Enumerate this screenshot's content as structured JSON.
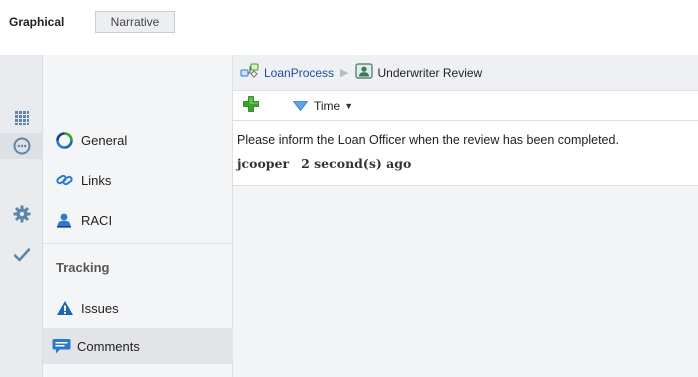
{
  "tabs": {
    "graphical": "Graphical",
    "narrative": "Narrative"
  },
  "nav": {
    "items": [
      {
        "label": "General",
        "icon": "refresh-circle-icon"
      },
      {
        "label": "Links",
        "icon": "chain-link-icon"
      },
      {
        "label": "RACI",
        "icon": "person-icon"
      }
    ],
    "tracking_heading": "Tracking",
    "tracking_items": [
      {
        "label": "Issues",
        "icon": "warning-triangle-icon"
      },
      {
        "label": "Comments",
        "icon": "speech-bubble-icon",
        "selected": true
      }
    ]
  },
  "rail": {
    "icons": [
      "grid-icon",
      "comment-circle-icon",
      "gear-icon",
      "checkmark-icon"
    ]
  },
  "breadcrumb": {
    "process": "LoanProcess",
    "current": "Underwriter Review"
  },
  "toolbar": {
    "sort_label": "Time"
  },
  "comments": [
    {
      "text": "Please inform the Loan Officer when the review has been completed.",
      "author": "jcooper",
      "time": "2 second(s) ago"
    }
  ],
  "colors": {
    "link": "#1f4e9a",
    "add_green": "#3aa42a",
    "warning_blue": "#1e63b4",
    "person_blue": "#2a7bd0",
    "rail_icon": "#5e86a8"
  }
}
